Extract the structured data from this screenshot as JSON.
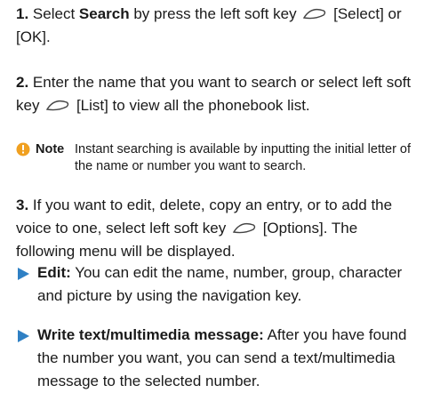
{
  "step1": {
    "number": "1.",
    "before": "Select ",
    "bold": "Search",
    "after": " by press the left soft key",
    "tail": "[Select] or [OK]."
  },
  "step2": {
    "number": "2.",
    "before": "Enter the name that you want to search or select left soft key",
    "tail": "[List] to view all the phonebook list."
  },
  "note": {
    "label": "Note",
    "text": "Instant searching is available by inputting the initial letter of the name or number you want to search."
  },
  "step3": {
    "number": "3.",
    "before": "If you want to edit, delete, copy an entry, or to add the voice to one, select left soft key",
    "tail": "[Options]. The following menu will be displayed."
  },
  "bullets": [
    {
      "title": "Edit:",
      "text": "You can edit the name, number, group, character and picture by using the navigation key."
    },
    {
      "title": "Write text/multimedia message:",
      "text": "After you have found the number you want, you can send a text/multimedia message to the selected number."
    }
  ],
  "colors": {
    "accent": "#2f80c4",
    "text": "#1a1a1a"
  },
  "icons": {
    "soft_key": "left-soft-key-icon",
    "note": "note-info-icon",
    "bullet": "triangle-arrow-icon"
  }
}
